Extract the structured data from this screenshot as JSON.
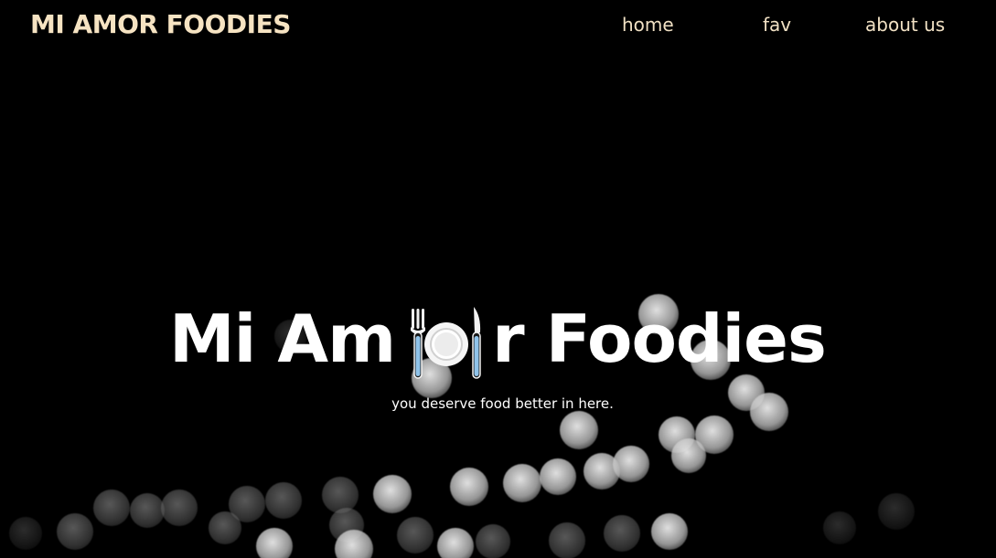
{
  "navbar": {
    "brand": "MI AMOR FOODIES",
    "links": {
      "home": "home",
      "fav": "fav",
      "about": "about us"
    }
  },
  "hero": {
    "title_before": "Mi Am",
    "title_icon": "plate-with-cutlery-icon",
    "title_after": "r Foodies",
    "subtitle": "you deserve food better in here."
  },
  "colors": {
    "background": "#000000",
    "brand_text": "#f6e3c2",
    "nav_text": "#f1e1c4",
    "hero_text": "#ffffff",
    "cutlery_blue": "#8fc3ea"
  }
}
